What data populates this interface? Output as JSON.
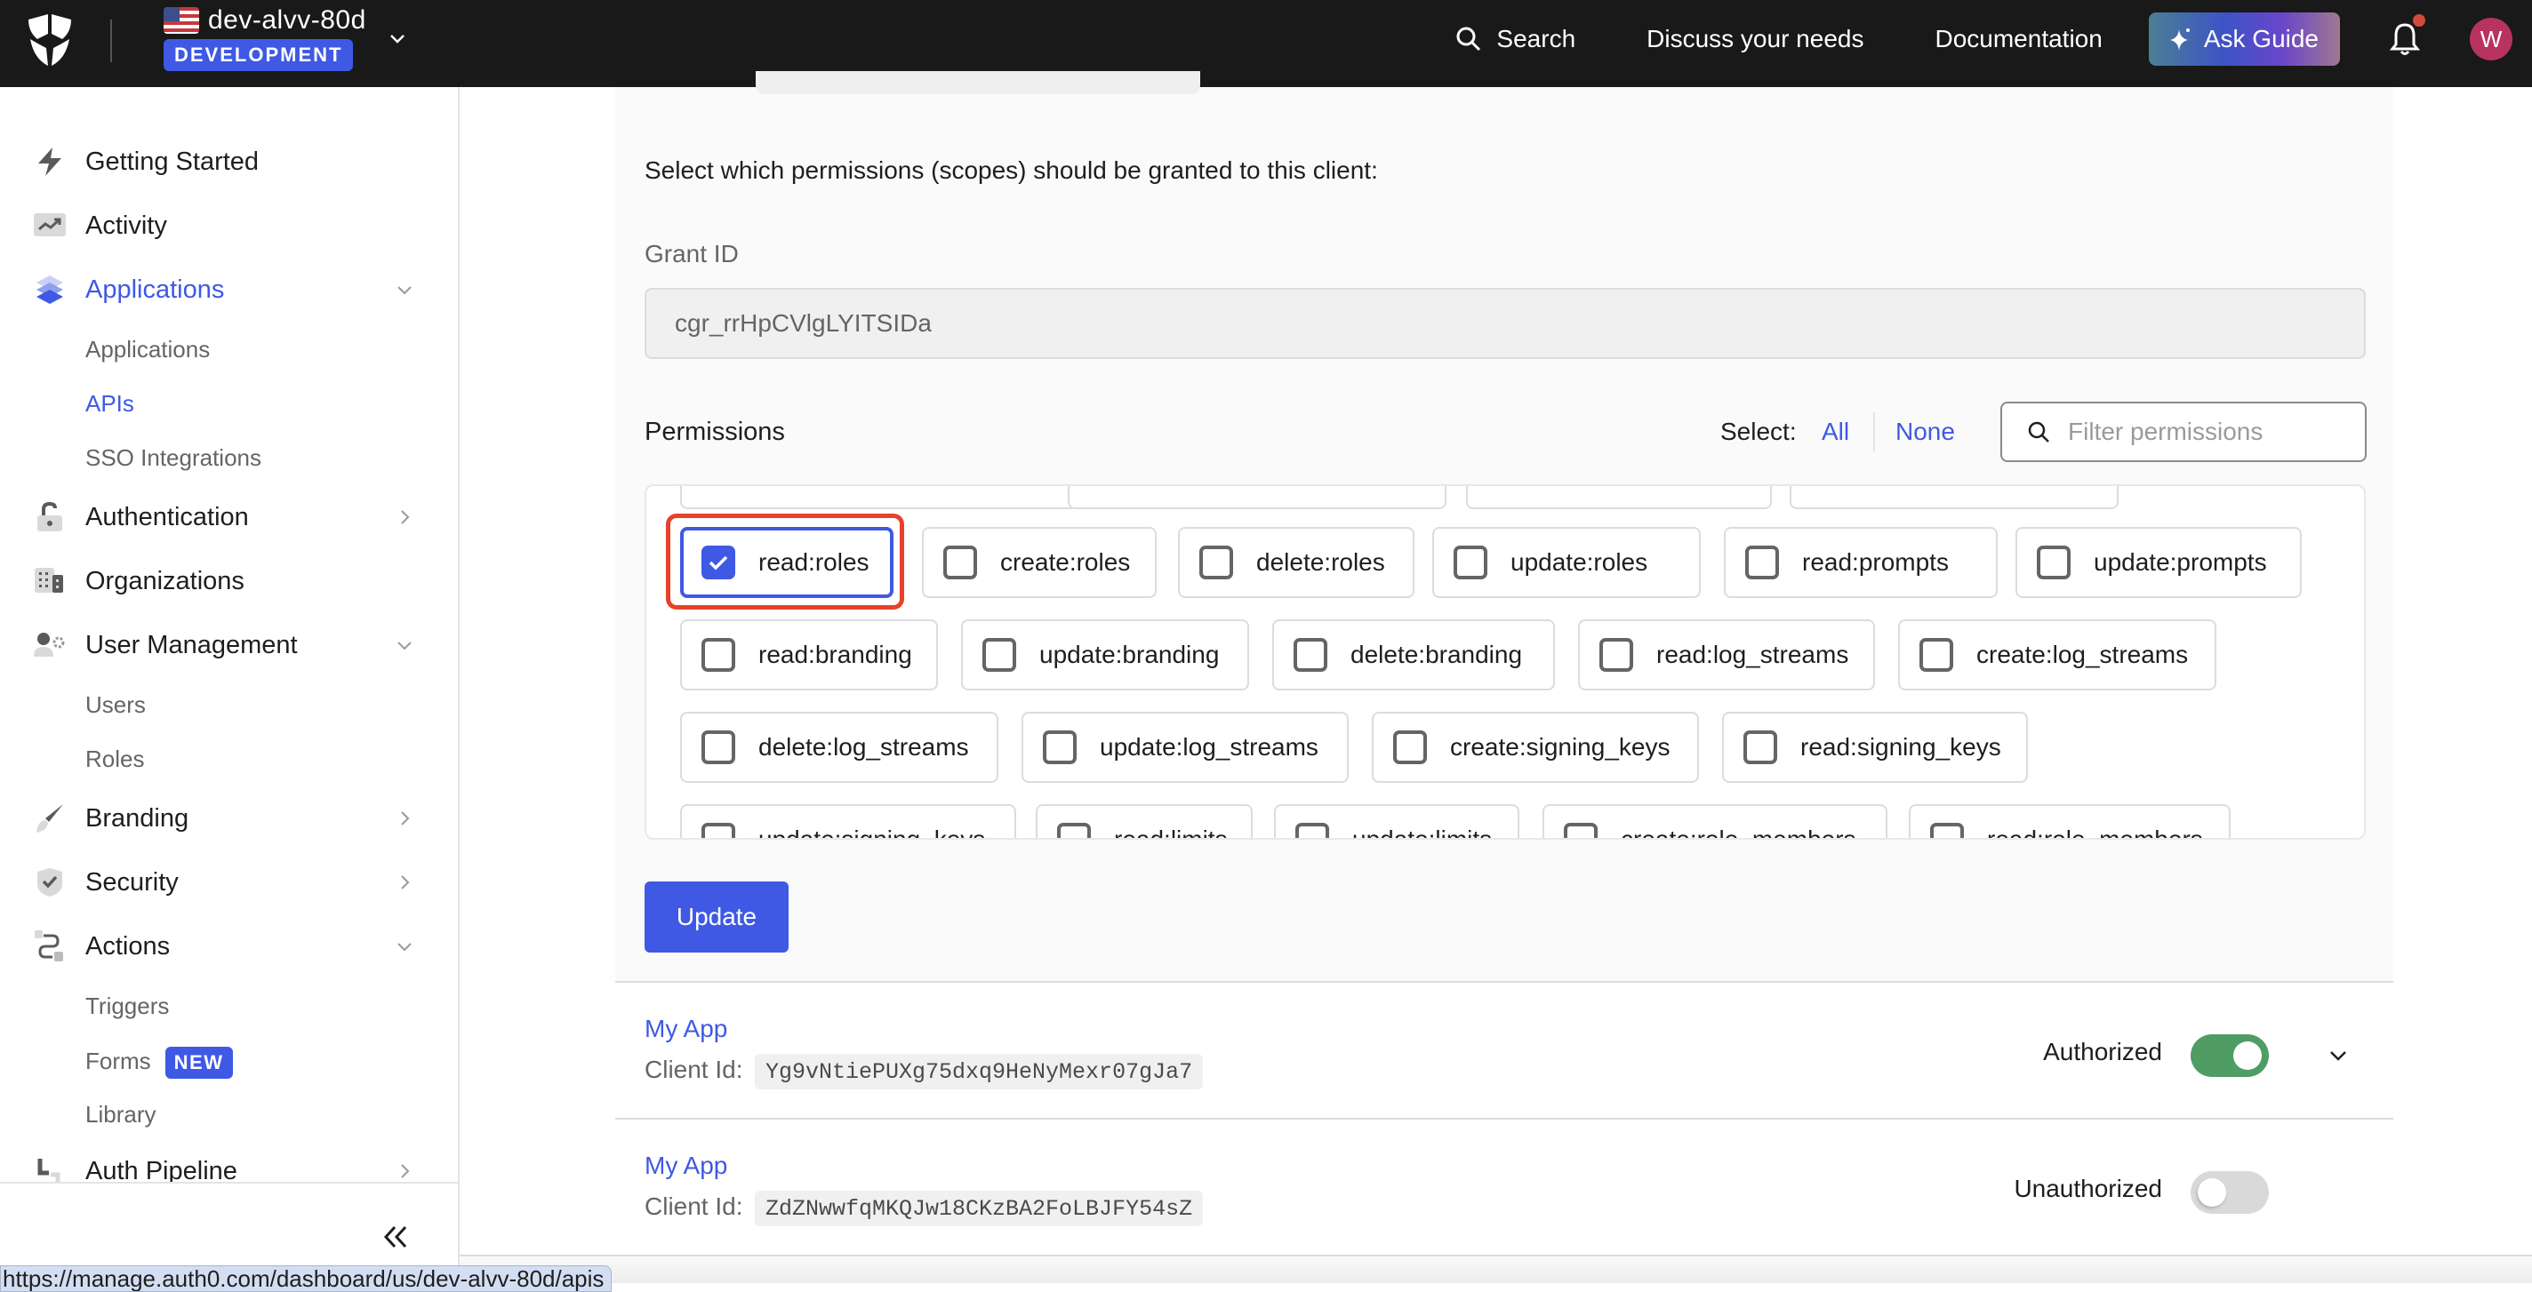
{
  "topbar": {
    "tenant_name": "dev-alvv-80d",
    "environment_badge": "DEVELOPMENT",
    "nav": {
      "search": "Search",
      "discuss": "Discuss your needs",
      "docs": "Documentation",
      "ask_guide": "Ask Guide"
    },
    "avatar_initial": "W",
    "notification_dot": true
  },
  "sidebar": {
    "items": [
      {
        "label": "Getting Started",
        "icon": "lightning-icon"
      },
      {
        "label": "Activity",
        "icon": "trend-chart-icon"
      },
      {
        "label": "Applications",
        "icon": "layers-icon",
        "active": true,
        "expanded": true
      },
      {
        "label": "Authentication",
        "icon": "lock-icon"
      },
      {
        "label": "Organizations",
        "icon": "building-icon"
      },
      {
        "label": "User Management",
        "icon": "user-gear-icon",
        "expanded": true
      },
      {
        "label": "Branding",
        "icon": "paintbrush-icon"
      },
      {
        "label": "Security",
        "icon": "shield-check-icon"
      },
      {
        "label": "Actions",
        "icon": "flow-icon",
        "expanded": true
      },
      {
        "label": "Auth Pipeline",
        "icon": "pipe-icon"
      }
    ],
    "applications_sub": [
      "Applications",
      "APIs",
      "SSO Integrations"
    ],
    "user_management_sub": [
      "Users",
      "Roles"
    ],
    "actions_sub": [
      "Triggers",
      "Forms",
      "Library"
    ],
    "forms_badge": "NEW",
    "active_sub": "APIs"
  },
  "status_url": "https://manage.auth0.com/dashboard/us/dev-alvv-80d/apis",
  "main": {
    "intro": "Select which permissions (scopes) should be granted to this client:",
    "grant_id_label": "Grant ID",
    "grant_id_value": "cgr_rrHpCVlgLYITSIDa",
    "permissions_heading": "Permissions",
    "select_label": "Select:",
    "select_all": "All",
    "select_none": "None",
    "filter_placeholder": "Filter permissions",
    "permissions": [
      {
        "label": "read:roles",
        "checked": true
      },
      {
        "label": "create:roles",
        "checked": false
      },
      {
        "label": "delete:roles",
        "checked": false
      },
      {
        "label": "update:roles",
        "checked": false
      },
      {
        "label": "read:prompts",
        "checked": false
      },
      {
        "label": "update:prompts",
        "checked": false
      },
      {
        "label": "read:branding",
        "checked": false
      },
      {
        "label": "update:branding",
        "checked": false
      },
      {
        "label": "delete:branding",
        "checked": false
      },
      {
        "label": "read:log_streams",
        "checked": false
      },
      {
        "label": "create:log_streams",
        "checked": false
      },
      {
        "label": "delete:log_streams",
        "checked": false
      },
      {
        "label": "update:log_streams",
        "checked": false
      },
      {
        "label": "create:signing_keys",
        "checked": false
      },
      {
        "label": "read:signing_keys",
        "checked": false
      },
      {
        "label": "update:signing_keys",
        "checked": false
      },
      {
        "label": "read:limits",
        "checked": false
      },
      {
        "label": "update:limits",
        "checked": false
      },
      {
        "label": "create:role_members",
        "checked": false
      },
      {
        "label": "read:role_members",
        "checked": false
      }
    ],
    "update_button": "Update",
    "apps": [
      {
        "name": "My App",
        "client_label": "Client Id:",
        "client_id": "Yg9vNtiePUXg75dxq9HeNyMexr07gJa7",
        "status": "Authorized",
        "authorized": true
      },
      {
        "name": "My App",
        "client_label": "Client Id:",
        "client_id": "ZdZNwwfqMKQJw18CKzBA2FoLBJFY54sZ",
        "status": "Unauthorized",
        "authorized": false
      }
    ]
  },
  "colors": {
    "accent": "#3f59e4",
    "topbar_bg": "#191919",
    "highlight": "#e8412b",
    "toggle_on": "#509c65",
    "toggle_off": "#d9d9d9",
    "avatar": "#b8335e"
  }
}
